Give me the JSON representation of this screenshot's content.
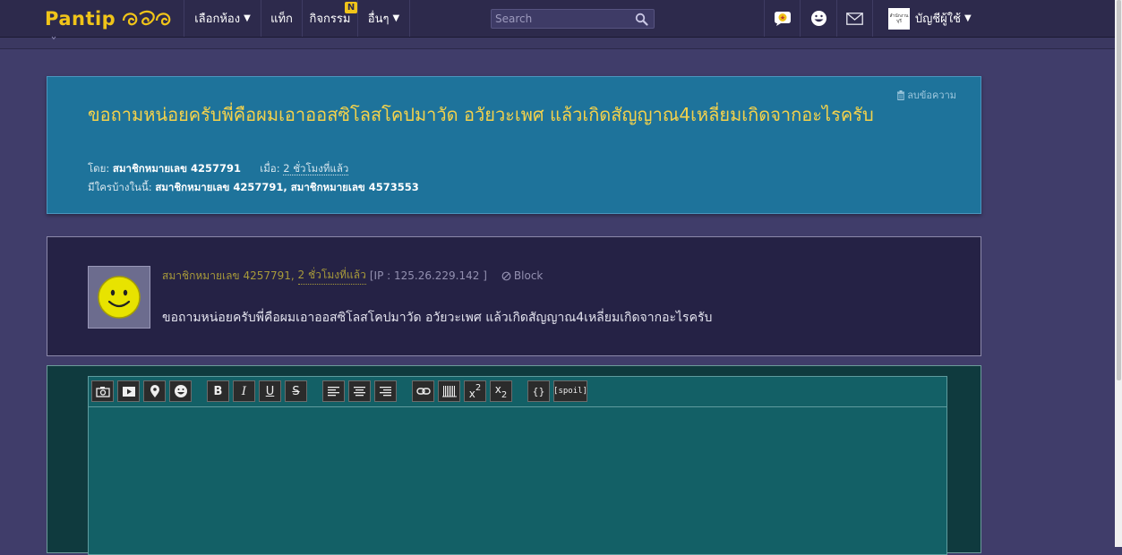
{
  "nav": {
    "logo": "Pantip",
    "menu": [
      {
        "label": "เลือกห้อง",
        "caret": "▼"
      },
      {
        "label": "แท็ก"
      },
      {
        "label": "กิจกรรม",
        "badge": "N"
      },
      {
        "label": "อื่นๆ",
        "caret": "▼"
      }
    ],
    "search_placeholder": "Search",
    "avatar_text": "สำนักงานบุรี",
    "account_label": "บัญชีผู้ใช้",
    "account_caret": "▼"
  },
  "topic": {
    "delete_label": "ลบข้อความ",
    "title": "ขอถามหน่อยครับพี่คือผมเอาออสซิโลสโคปมาวัด อวัยวะเพศ แล้วเกิดสัญญาณ4เหลี่ยมเกิดจากอะไรครับ",
    "by_label": "โดย:",
    "author": "สมาชิกหมายเลข 4257791",
    "when_label": "เมื่อ:",
    "time": "2 ชั่วโมงที่แล้ว",
    "viewers_label": "มีใครบ้างในนี้:",
    "viewers": "สมาชิกหมายเลข 4257791, สมาชิกหมายเลข 4573553"
  },
  "comment": {
    "author": "สมาชิกหมายเลข 4257791",
    "separator": ",",
    "time": "2 ชั่วโมงที่แล้ว",
    "ip": "[IP : 125.26.229.142 ]",
    "block_label": "Block",
    "text": "ขอถามหน่อยครับพี่คือผมเอาออสซิโลสโคปมาวัด อวัยวะเพศ แล้วเกิดสัญญาณ4เหลี่ยมเกิดจากอะไรครับ"
  },
  "editor": {
    "bold": "B",
    "italic": "I",
    "underline": "U",
    "strike": "S",
    "code": "{}",
    "spoil": "[spoil]",
    "sup_base": "x",
    "sup_exp": "2",
    "sub_base": "x",
    "sub_exp": "2"
  },
  "colors": {
    "accent": "#f0c419",
    "topic_bg": "#1e739b",
    "comment_bg": "#252245",
    "reply_bg": "#136066"
  }
}
